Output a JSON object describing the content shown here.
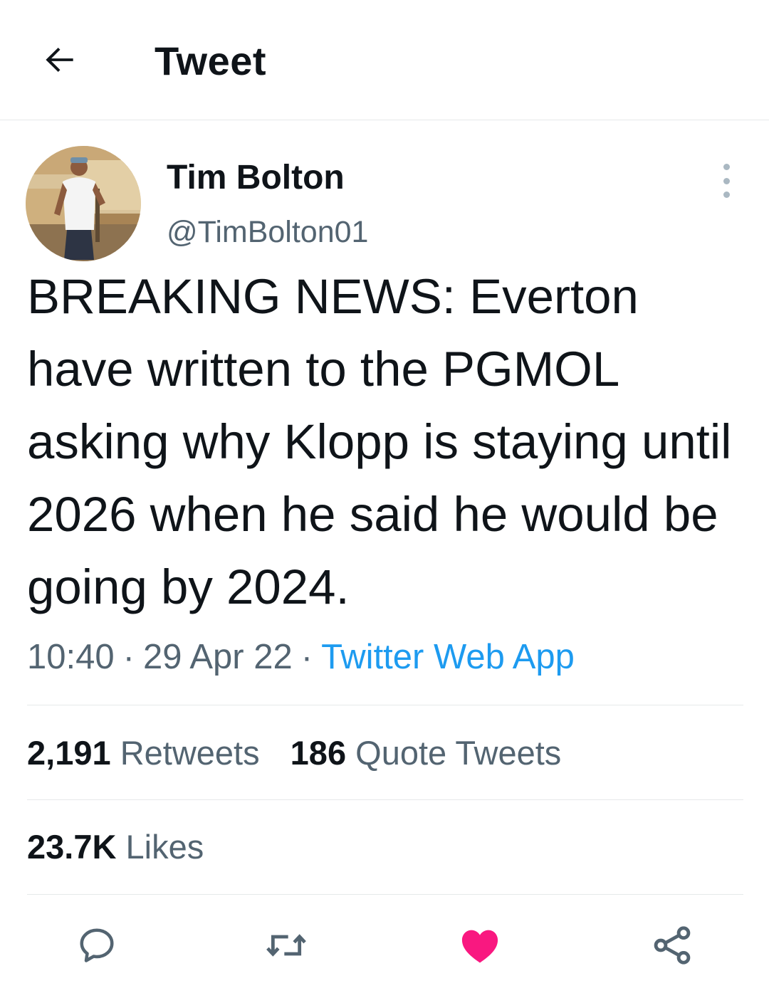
{
  "header": {
    "title": "Tweet",
    "back_icon": "arrow-left-icon"
  },
  "author": {
    "name": "Tim Bolton",
    "handle": "@TimBolton01",
    "avatar_icon": "avatar-photo"
  },
  "tweet": {
    "text": "BREAKING NEWS: Everton have written to the PGMOL asking why Klopp is staying until 2026 when he said he would be going by 2024.",
    "time": "10:40",
    "date": "29 Apr 22",
    "separator": "·",
    "source": "Twitter Web App"
  },
  "stats": {
    "retweets_count": "2,191",
    "retweets_label": "Retweets",
    "quotes_count": "186",
    "quotes_label": "Quote Tweets",
    "likes_count": "23.7K",
    "likes_label": "Likes"
  },
  "actions": {
    "icons": [
      "reply-icon",
      "retweet-icon",
      "heart-icon",
      "share-icon"
    ]
  },
  "colors": {
    "link": "#1d9bf0",
    "like": "#f91880",
    "secondary_text": "#536471",
    "divider": "#e6e9ea"
  }
}
